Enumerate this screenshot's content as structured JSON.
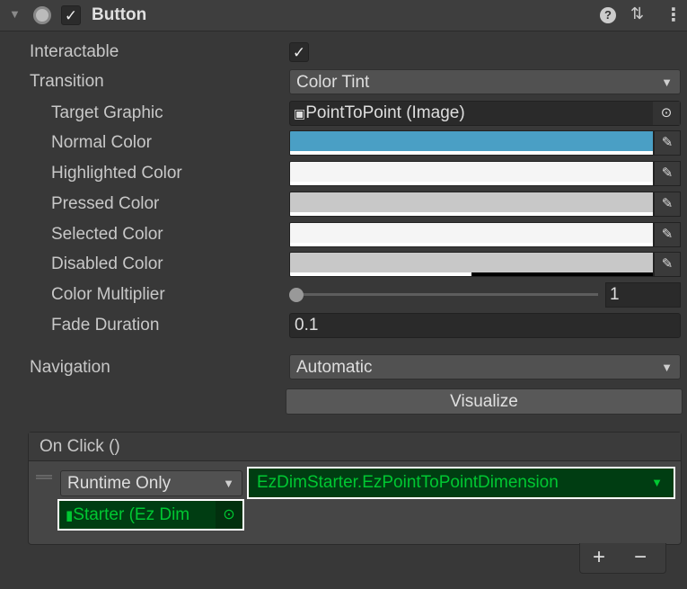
{
  "component": {
    "title": "Button",
    "enabled": true,
    "icons": [
      "foldout-arrow-icon",
      "component-icon",
      "help-icon",
      "preset-icon",
      "more-icon"
    ]
  },
  "props": {
    "interactable": {
      "label": "Interactable",
      "value": true
    },
    "transition": {
      "label": "Transition",
      "value": "Color Tint"
    },
    "target_graphic": {
      "label": "Target Graphic",
      "value": "PointToPoint (Image)"
    },
    "normal_color": {
      "label": "Normal Color",
      "color": "#4a9fc5",
      "alpha": 1
    },
    "highlighted_color": {
      "label": "Highlighted Color",
      "color": "#f5f5f5",
      "alpha": 1
    },
    "pressed_color": {
      "label": "Pressed Color",
      "color": "#c8c8c8",
      "alpha": 1
    },
    "selected_color": {
      "label": "Selected Color",
      "color": "#f5f5f5",
      "alpha": 1
    },
    "disabled_color": {
      "label": "Disabled Color",
      "color": "#c8c8c8",
      "alpha": 0.5
    },
    "color_multiplier": {
      "label": "Color Multiplier",
      "value": "1",
      "slider_fraction": 0
    },
    "fade_duration": {
      "label": "Fade Duration",
      "value": "0.1"
    },
    "navigation": {
      "label": "Navigation",
      "value": "Automatic"
    },
    "visualize": {
      "label": "Visualize"
    }
  },
  "on_click": {
    "title": "On Click ()",
    "call_state": "Runtime Only",
    "function": "EzDimStarter.EzPointToPointDimension",
    "target": "Starter (Ez Dim",
    "add": "+",
    "remove": "−"
  },
  "colors": {
    "highlight_green": "#00c832",
    "highlight_bg": "#003d12"
  }
}
